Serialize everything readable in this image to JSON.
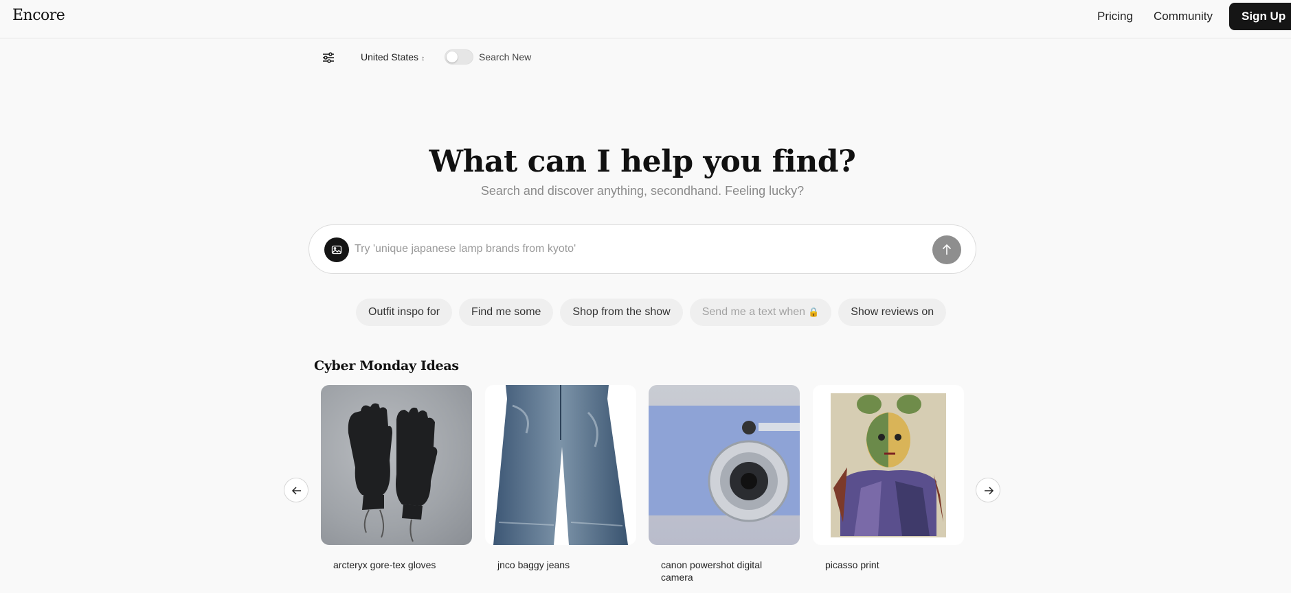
{
  "app": {
    "brand": "Encore"
  },
  "nav": {
    "pricing": "Pricing",
    "community": "Community",
    "signup": "Sign Up"
  },
  "filters": {
    "country": "United States",
    "toggle_label": "Search New",
    "search_new_enabled": false
  },
  "hero": {
    "title": "What can I help you find?",
    "subtitle": "Search and discover anything, secondhand. Feeling lucky?"
  },
  "search": {
    "placeholder": "Try 'unique japanese lamp brands from kyoto'",
    "value": ""
  },
  "chips": [
    {
      "label": "Outfit inspo for"
    },
    {
      "label": "Find me some"
    },
    {
      "label": "Shop from the show"
    },
    {
      "label": "Send me a text when",
      "icon": "lock-icon"
    },
    {
      "label": "Show reviews on"
    }
  ],
  "section": {
    "title": "Cyber Monday Ideas",
    "items": [
      {
        "label": "arcteryx gore-tex gloves",
        "image": "gloves-image"
      },
      {
        "label": "jnco baggy jeans",
        "image": "jeans-image"
      },
      {
        "label": "canon powershot digital camera",
        "image": "camera-image"
      },
      {
        "label": "picasso print",
        "image": "painting-image"
      }
    ]
  },
  "colors": {
    "background": "#f9f9f9",
    "primary": "#151515",
    "muted_text": "#8a8a8a",
    "chip_bg": "#efefef"
  }
}
